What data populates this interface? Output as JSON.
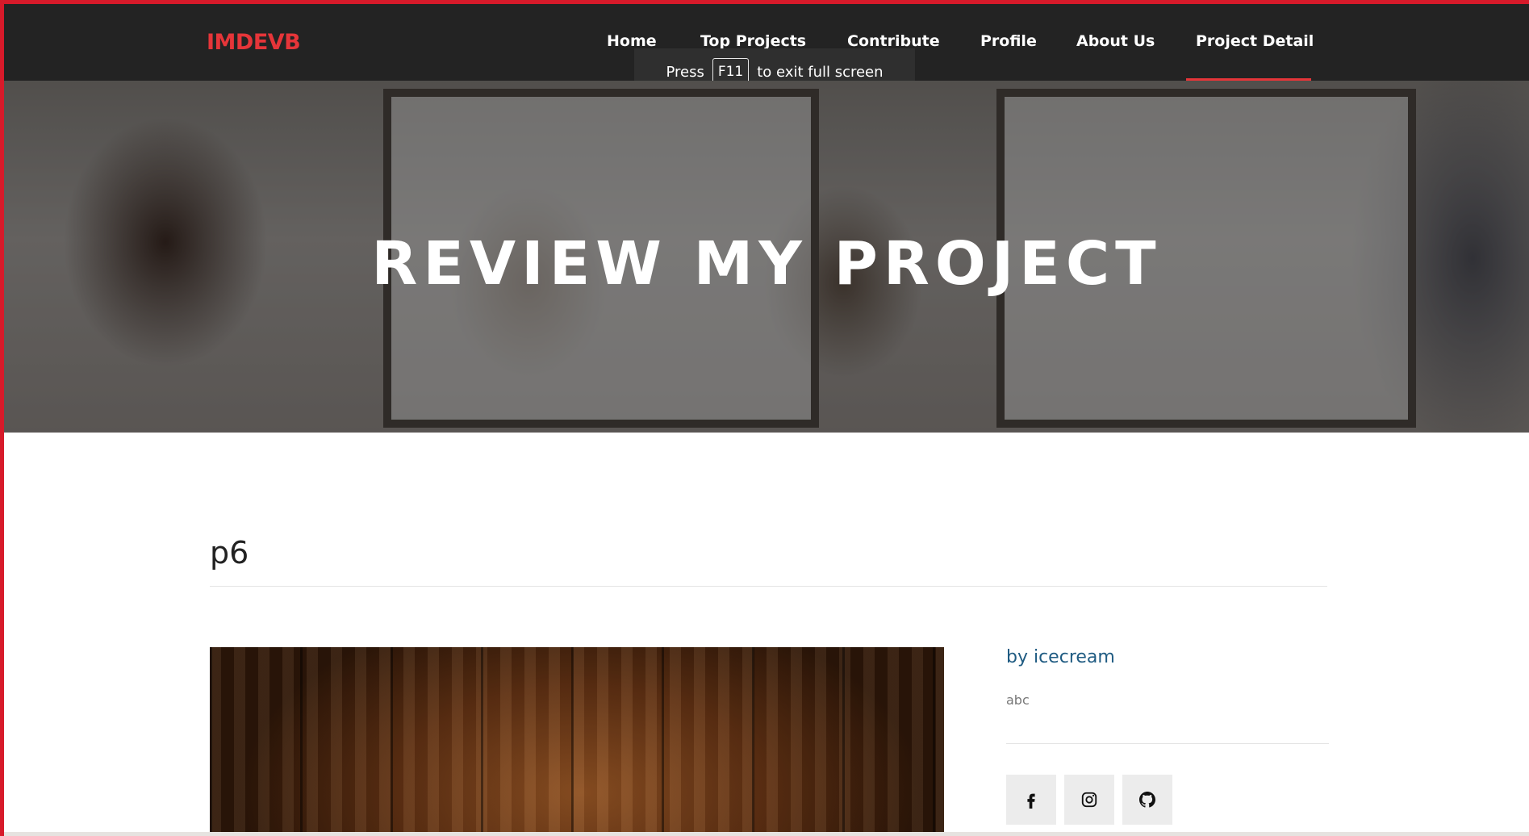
{
  "navbar": {
    "brand": "IMDEVB",
    "items": [
      {
        "label": "Home"
      },
      {
        "label": "Top Projects"
      },
      {
        "label": "Contribute"
      },
      {
        "label": "Profile"
      },
      {
        "label": "About Us"
      },
      {
        "label": "Project Detail"
      }
    ],
    "active_item": "Project Detail"
  },
  "fullscreen_toast": {
    "press": "Press",
    "key": "F11",
    "suffix": "to exit full screen"
  },
  "hero": {
    "title": "REVIEW MY PROJECT"
  },
  "project": {
    "title": "p6",
    "author": "by icecream",
    "description": "abc"
  },
  "social": [
    {
      "icon": "facebook-icon"
    },
    {
      "icon": "instagram-icon"
    },
    {
      "icon": "github-icon"
    }
  ],
  "colors": {
    "accent": "#e63539",
    "navbar_bg": "#232323",
    "author_text": "#1f5b82",
    "window_border": "#d71a2a"
  }
}
